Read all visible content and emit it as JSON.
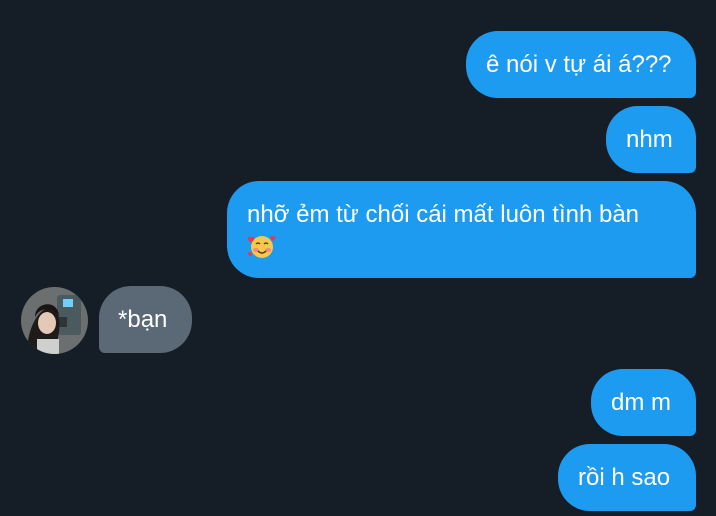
{
  "conversation": {
    "messages": [
      {
        "direction": "sent",
        "text": "ê nói v tự ái á???"
      },
      {
        "direction": "sent",
        "text": "nhm"
      },
      {
        "direction": "sent",
        "text": "nhỡ ẻm từ chối cái mất luôn tình bàn",
        "emoji": "smiling-face-with-hearts"
      },
      {
        "direction": "received",
        "text": "*bạn"
      },
      {
        "direction": "sent",
        "text": "dm m"
      },
      {
        "direction": "sent",
        "text": "rồi h sao"
      }
    ],
    "contact_avatar": "contact-avatar-photo"
  },
  "colors": {
    "background": "#151d26",
    "sent_bubble": "#1d9bf0",
    "received_bubble": "#5b6976",
    "text": "#ffffff"
  }
}
